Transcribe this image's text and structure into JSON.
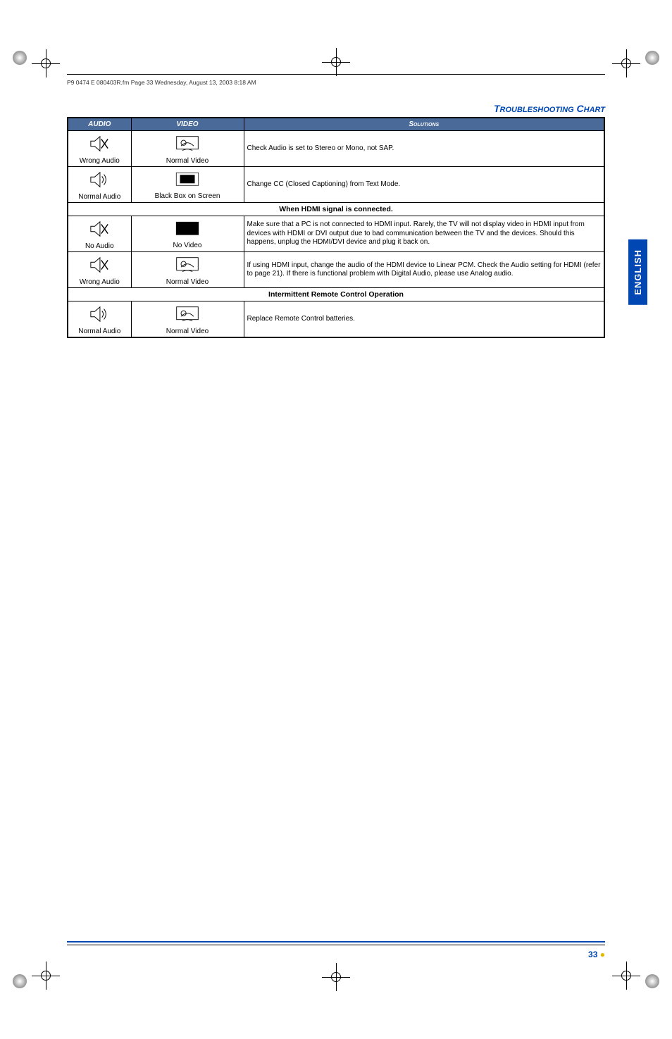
{
  "running_header": "P9 0474 E  080403R.fm  Page 33  Wednesday, August 13, 2003  8:18 AM",
  "title_main": "T",
  "title_rest1": "ROUBLESHOOTING",
  "title_main2": " C",
  "title_rest2": "HART",
  "headers": {
    "audio": "AUDIO",
    "video": "VIDEO",
    "solutions": "Solutions"
  },
  "rows": [
    {
      "audio_label": "Wrong Audio",
      "video_label": "Normal Video",
      "solution": "Check Audio is set to Stereo or Mono, not SAP.",
      "audio_icon": "speaker-x",
      "video_icon": "tv-picture"
    },
    {
      "audio_label": "Normal Audio",
      "video_label": "Black Box on Screen",
      "solution": "Change CC (Closed Captioning) from Text Mode.",
      "audio_icon": "speaker-sound",
      "video_icon": "tv-blackbox"
    }
  ],
  "subhead1": "When HDMI signal is connected.",
  "rows_hdmi": [
    {
      "audio_label": "No Audio",
      "video_label": "No Video",
      "solution": "Make sure that a PC is not connected to HDMI input.\nRarely, the TV will not display video in HDMI input from devices with HDMI or DVI output due to bad communication between the TV and the devices. Should this happens, unplug the HDMI/DVI device and plug it back on.",
      "audio_icon": "speaker-x",
      "video_icon": "tv-black"
    },
    {
      "audio_label": "Wrong Audio",
      "video_label": "Normal Video",
      "solution": "If using HDMI input, change the audio of the HDMI device to Linear PCM. Check the Audio setting for HDMI (refer to page 21). If there is functional problem with Digital Audio, please use Analog audio.",
      "audio_icon": "speaker-x",
      "video_icon": "tv-picture"
    }
  ],
  "subhead2": "Intermittent Remote Control Operation",
  "rows_remote": [
    {
      "audio_label": "Normal Audio",
      "video_label": "Normal Video",
      "solution": "Replace Remote Control batteries.",
      "audio_icon": "speaker-sound",
      "video_icon": "tv-picture"
    }
  ],
  "side_tab": "ENGLISH",
  "page_number": "33",
  "bullet": "●"
}
